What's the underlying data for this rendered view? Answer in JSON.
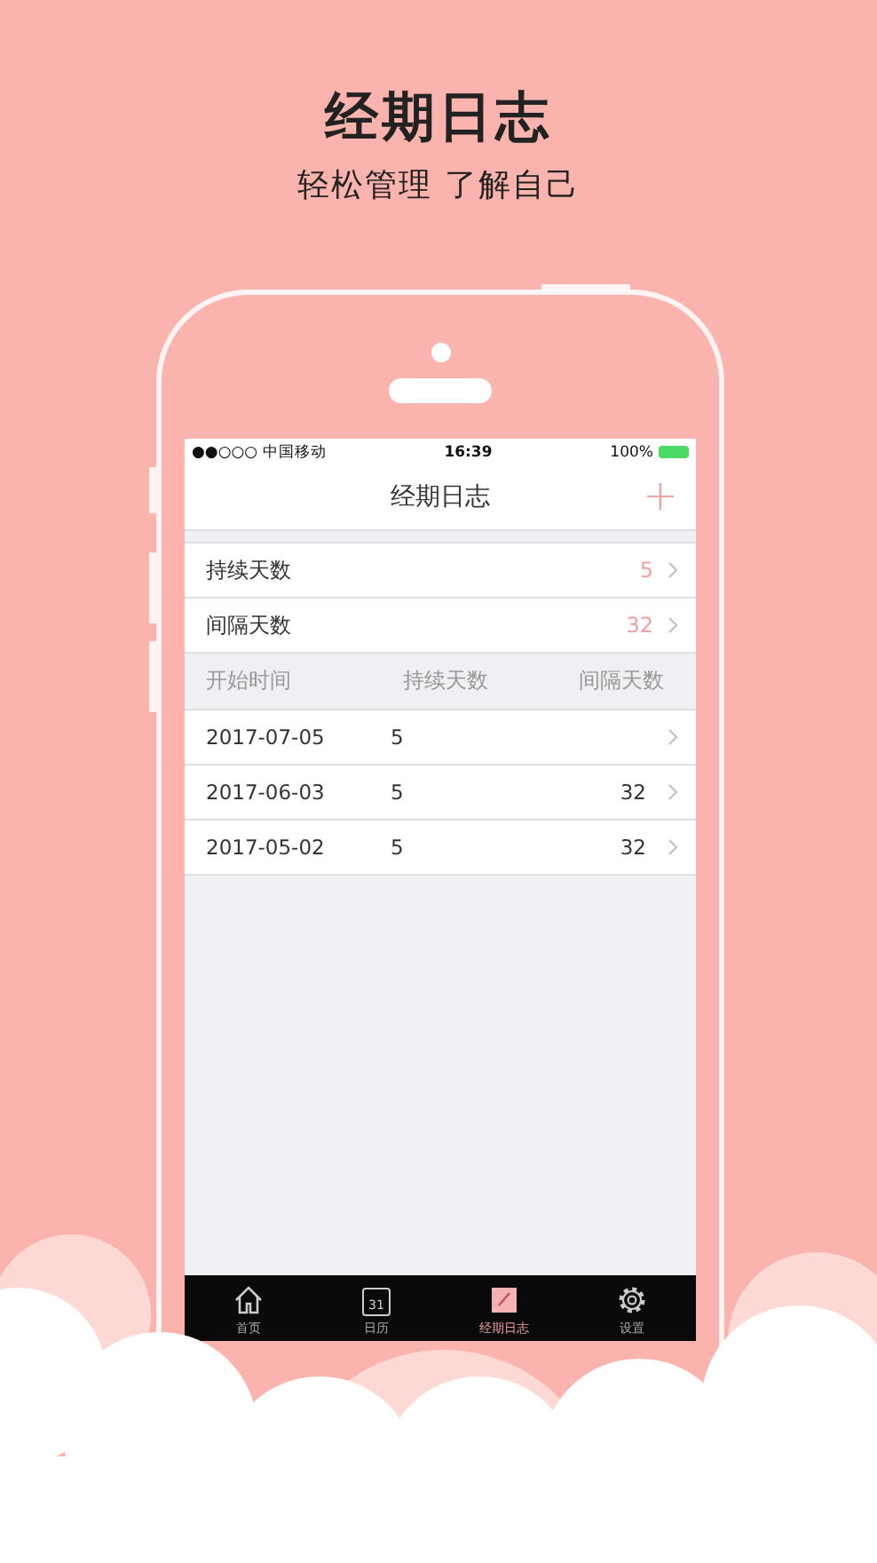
{
  "headline": "经期日志",
  "tagline": "轻松管理 了解自己",
  "status_bar": {
    "carrier": "●●○○○ 中国移动",
    "time": "16:39",
    "battery": "100%"
  },
  "nav_bar": {
    "title": "经期日志",
    "action": "+"
  },
  "summary": [
    {
      "label": "持续天数",
      "value": "5"
    },
    {
      "label": "间隔天数",
      "value": "32"
    }
  ],
  "table": {
    "columns": [
      "开始时间",
      "持续天数",
      "间隔天数"
    ],
    "rows": [
      [
        "2017-07-05",
        "5",
        ""
      ],
      [
        "2017-06-03",
        "5",
        "32"
      ],
      [
        "2017-05-02",
        "5",
        "32"
      ]
    ]
  },
  "tab_bar": [
    {
      "kind": "home",
      "label": "首页",
      "selected": false
    },
    {
      "kind": "calendar",
      "label": "日历",
      "icon_text": "31",
      "selected": false
    },
    {
      "kind": "journal",
      "label": "经期日志",
      "selected": true
    },
    {
      "kind": "settings",
      "label": "设置",
      "selected": false
    }
  ]
}
